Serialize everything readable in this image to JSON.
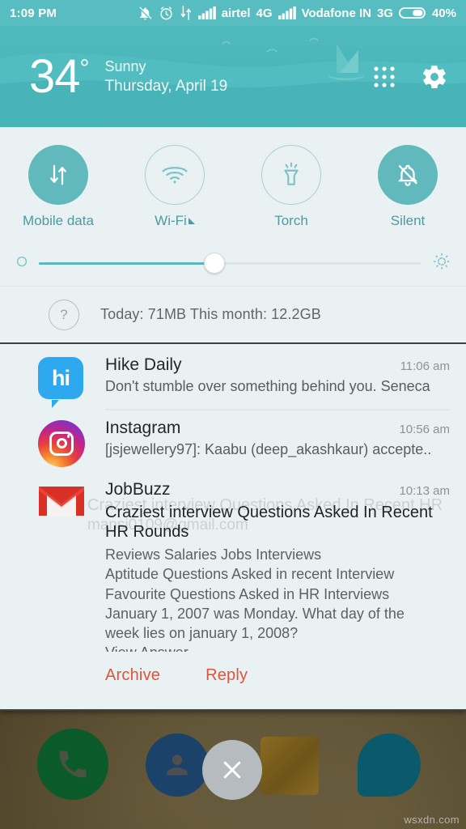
{
  "status_bar": {
    "clock": "1:09 PM",
    "icons": [
      "silent-bell-icon",
      "alarm-icon",
      "data-transfer-icon",
      "signal-bars-icon"
    ],
    "sim1_carrier": "airtel",
    "sim1_network": "4G",
    "sim2_carrier": "Vodafone IN",
    "sim2_network": "3G",
    "battery_percent": "40%",
    "battery_level": 40,
    "background_color": "#57bdc0"
  },
  "weather_header": {
    "temperature": "34",
    "degree_symbol": "°",
    "condition": "Sunny",
    "date": "Thursday, April 19",
    "grid_button": "edit-toggles",
    "settings_button": "settings",
    "background_color": "#4fb9bd"
  },
  "quick_settings": {
    "tiles": [
      {
        "label": "Mobile data",
        "icon": "mobile-data-icon",
        "state": "on"
      },
      {
        "label": "Wi-Fi",
        "icon": "wifi-icon",
        "state": "off",
        "has_caret": true
      },
      {
        "label": "Torch",
        "icon": "torch-icon",
        "state": "off"
      },
      {
        "label": "Silent",
        "icon": "silent-bell-icon",
        "state": "on"
      }
    ],
    "accent_color": "#62b9bd",
    "label_color": "#4a9ba6"
  },
  "brightness": {
    "low_icon": "brightness-low-icon",
    "high_icon": "brightness-high-icon",
    "value_percent": 46,
    "fill_color": "#5bb7bb"
  },
  "data_usage": {
    "help_icon": "?",
    "text": "Today: 71MB   This month: 12.2GB",
    "today_label": "Today:",
    "today_value": "71MB",
    "month_label": "This month:",
    "month_value": "12.2GB"
  },
  "notifications": [
    {
      "app": "Hike Daily",
      "icon": "hike-icon",
      "icon_text": "hi",
      "time": "11:06 am",
      "text": "Don't stumble over something behind you. Seneca"
    },
    {
      "app": "Instagram",
      "icon": "instagram-icon",
      "time": "10:56 am",
      "text": "[jsjewellery97]: Kaabu (deep_akashkaur) accepte.."
    },
    {
      "app": "JobBuzz",
      "icon": "gmail-icon",
      "time": "10:13 am",
      "subject": "Craziest interview Questions Asked In Recent HR Rounds",
      "ghost_subject": "Craziest interview Questions Asked In Recent HR",
      "ghost_sender": "mansi0109@gmail.com",
      "body_lines": [
        "Reviews  Salaries  Jobs   Interviews",
        "Aptitude Questions Asked in recent Interview",
        "Favourite Questions Asked in HR Interviews",
        "January 1, 2007 was Monday. What day of the",
        "week lies on january 1, 2008?"
      ],
      "clipped_line": "View Answer",
      "actions": [
        {
          "label": "Archive",
          "name": "archive-button"
        },
        {
          "label": "Reply",
          "name": "reply-button"
        }
      ],
      "action_color": "#e2533f"
    }
  ],
  "dock": {
    "items": [
      {
        "name": "phone-icon",
        "color": "#0a5a2a"
      },
      {
        "name": "contacts-icon",
        "color": "#1b4269"
      },
      {
        "name": "mail-icon",
        "color": "#8a6b22"
      },
      {
        "name": "chat-icon",
        "color": "#0b5a6b"
      }
    ],
    "clear_all": {
      "name": "clear-all-button",
      "glyph": "✕",
      "color": "#b6bbc0"
    }
  },
  "watermark": {
    "text": "wsxdn.com"
  }
}
